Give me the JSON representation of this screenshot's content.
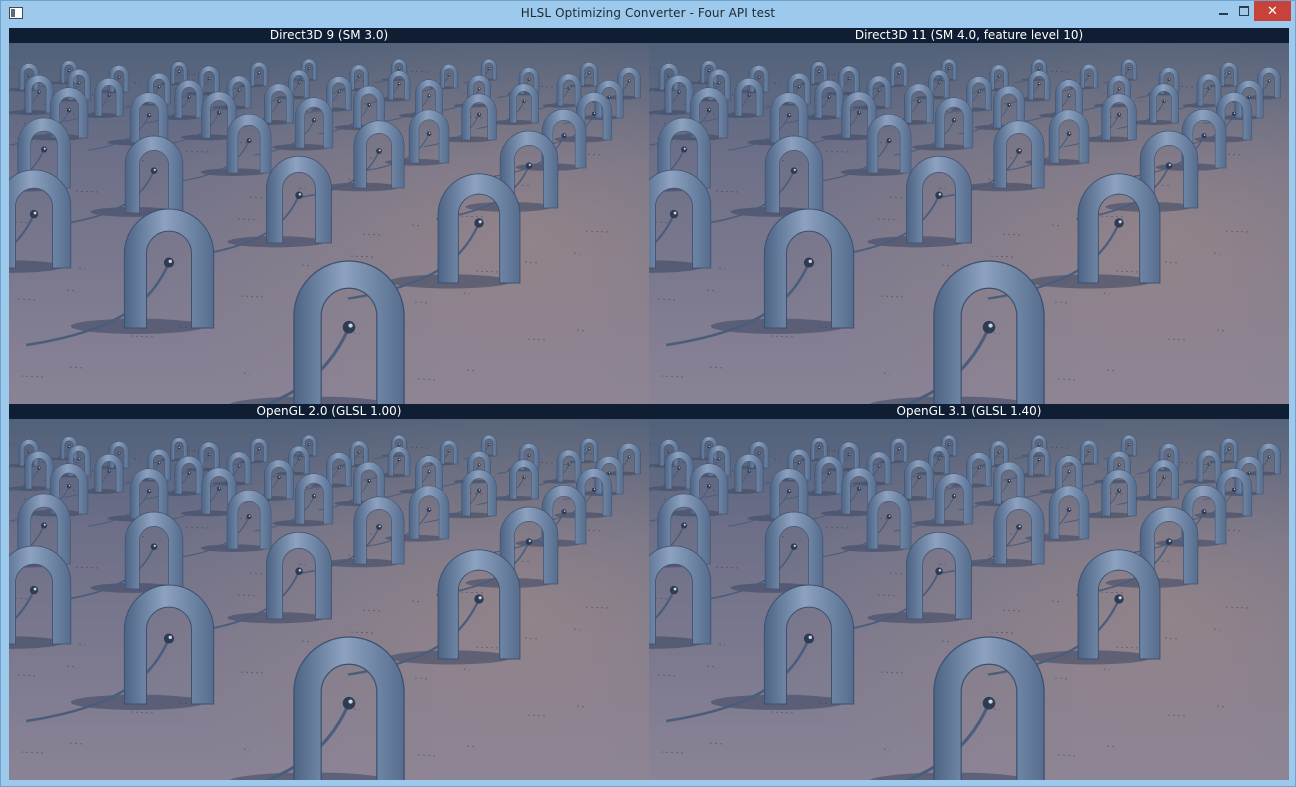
{
  "window": {
    "title": "HLSL Optimizing Converter - Four API test",
    "controls": {
      "minimize": "minimize-icon",
      "maximize": "maximize-icon",
      "close": "close-icon",
      "close_color": "#c7423a"
    }
  },
  "viewports": [
    {
      "label": "Direct3D 9 (SM 3.0)"
    },
    {
      "label": "Direct3D 11 (SM 4.0, feature level 10)"
    },
    {
      "label": "OpenGL 2.0 (GLSL 1.00)"
    },
    {
      "label": "OpenGL 3.1 (GLSL 1.40)"
    }
  ],
  "colors": {
    "label_bar": "#0f1e33",
    "frame": "#9cc9ec",
    "sky": "#3e5470",
    "floor": "#8a8396",
    "arch": "#6f86a6"
  }
}
